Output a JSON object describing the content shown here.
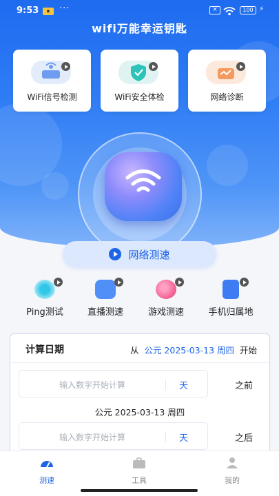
{
  "status_bar": {
    "time": "9:53",
    "battery": "100"
  },
  "app_title": "wifi万能幸运钥匙",
  "features": [
    {
      "label": "WiFi信号检测",
      "icon": "router-icon"
    },
    {
      "label": "WiFi安全体检",
      "icon": "shield-icon"
    },
    {
      "label": "网络诊断",
      "icon": "network-diagnose-icon"
    }
  ],
  "speed_test_label": "网络测速",
  "tools": [
    {
      "label": "Ping测试",
      "icon": "ping-icon"
    },
    {
      "label": "直播测速",
      "icon": "video-camera-icon"
    },
    {
      "label": "游戏测速",
      "icon": "game-icon"
    },
    {
      "label": "手机归属地",
      "icon": "phone-icon"
    }
  ],
  "calc": {
    "title": "计算日期",
    "range_prefix": "从",
    "range_date": "公元 2025-03-13 周四",
    "range_suffix": "开始",
    "input_placeholder": "输入数字开始计算",
    "unit": "天",
    "before_label": "之前",
    "middle_date": "公元 2025-03-13 周四",
    "after_label": "之后"
  },
  "nav": [
    {
      "label": "测速",
      "active": true
    },
    {
      "label": "工具",
      "active": false
    },
    {
      "label": "我的",
      "active": false
    }
  ],
  "colors": {
    "primary": "#1e64e6",
    "hero_top": "#1e6bf0",
    "hero_bottom": "#7fb2fa"
  }
}
